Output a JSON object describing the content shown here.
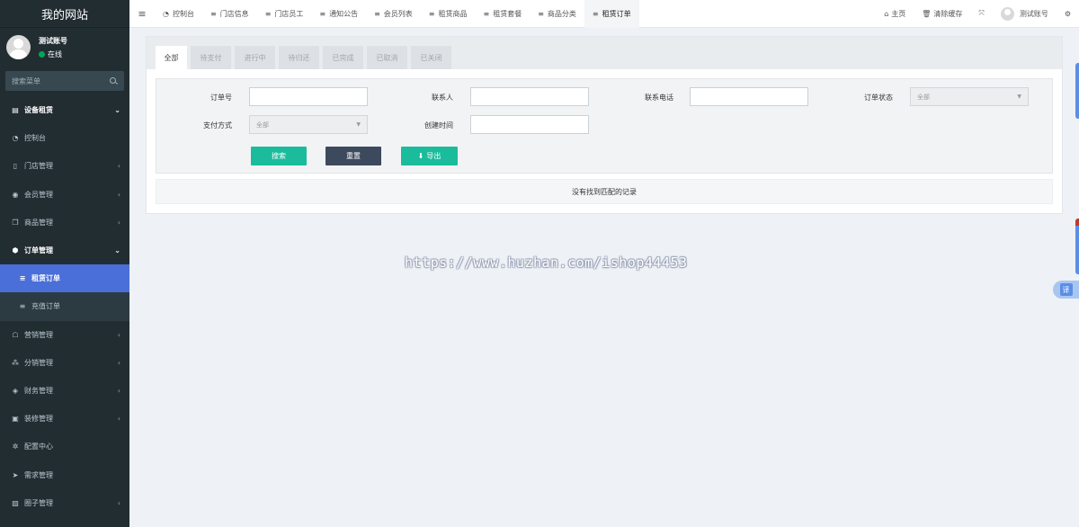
{
  "sidebar": {
    "logo": "我的网站",
    "user_name": "测试账号",
    "user_status": "在线",
    "search_placeholder": "搜索菜单",
    "items": [
      {
        "label": "设备租赁",
        "icon": "▤",
        "caret": "⌄"
      },
      {
        "label": "控制台",
        "icon": "◔",
        "caret": ""
      },
      {
        "label": "门店管理",
        "icon": "▯",
        "caret": "‹"
      },
      {
        "label": "会员管理",
        "icon": "◉",
        "caret": "‹"
      },
      {
        "label": "商品管理",
        "icon": "❐",
        "caret": "‹"
      },
      {
        "label": "订单管理",
        "icon": "⬢",
        "caret": "⌄"
      },
      {
        "label": "租赁订单",
        "icon": "≡",
        "caret": ""
      },
      {
        "label": "充值订单",
        "icon": "≡",
        "caret": ""
      },
      {
        "label": "营销管理",
        "icon": "☖",
        "caret": "‹"
      },
      {
        "label": "分销管理",
        "icon": "⁂",
        "caret": "‹"
      },
      {
        "label": "财务管理",
        "icon": "◈",
        "caret": "‹"
      },
      {
        "label": "装修管理",
        "icon": "▣",
        "caret": "‹"
      },
      {
        "label": "配置中心",
        "icon": "✲",
        "caret": ""
      },
      {
        "label": "需求管理",
        "icon": "➤",
        "caret": ""
      },
      {
        "label": "圈子管理",
        "icon": "▨",
        "caret": "‹"
      }
    ]
  },
  "topbar": {
    "menu_icon": "≡",
    "tabs": [
      {
        "label": "控制台",
        "icon": "◔"
      },
      {
        "label": "门店信息",
        "icon": "≡"
      },
      {
        "label": "门店员工",
        "icon": "≡"
      },
      {
        "label": "通知公告",
        "icon": "≡"
      },
      {
        "label": "会员列表",
        "icon": "≡"
      },
      {
        "label": "租赁商品",
        "icon": "≡"
      },
      {
        "label": "租赁套餐",
        "icon": "≡"
      },
      {
        "label": "商品分类",
        "icon": "≡"
      },
      {
        "label": "租赁订单",
        "icon": "≡"
      }
    ],
    "home": "主页",
    "clear_cache": "清除缓存",
    "fullscreen_icon": "⤧",
    "account": "测试账号",
    "settings_icon": "⚙"
  },
  "order_tabs": [
    "全部",
    "待支付",
    "进行中",
    "待归还",
    "已完成",
    "已取消",
    "已关闭"
  ],
  "filters": {
    "order_no_label": "订单号",
    "contact_label": "联系人",
    "phone_label": "联系电话",
    "order_status_label": "订单状态",
    "order_status_value": "全部",
    "pay_method_label": "支付方式",
    "pay_method_value": "全部",
    "created_label": "创建时间"
  },
  "buttons": {
    "search": "搜索",
    "reset": "重置",
    "export": "导出"
  },
  "table": {
    "empty_text": "没有找到匹配的记录"
  },
  "watermark": "https://www.huzhan.com/ishop44453",
  "translate_label": "译"
}
